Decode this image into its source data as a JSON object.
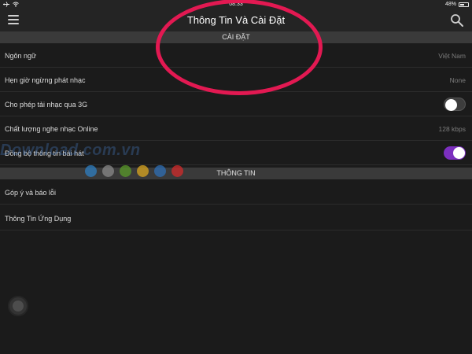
{
  "status_bar": {
    "time": "08:33",
    "battery": "48%"
  },
  "nav": {
    "title": "Thông Tin Và Cài Đặt"
  },
  "settings_section": {
    "title": "CÀI ĐẶT",
    "rows": [
      {
        "label": "Ngôn ngữ",
        "value": "Việt Nam"
      },
      {
        "label": "Hẹn giờ ngừng phát nhạc",
        "value": "None"
      },
      {
        "label": "Cho phép tải nhạc qua 3G",
        "toggle": "off"
      },
      {
        "label": "Chất lượng nghe nhạc Online",
        "value": "128 kbps"
      },
      {
        "label": "Đồng bộ thông tin bài hát",
        "toggle": "on"
      }
    ]
  },
  "info_section": {
    "title": "THÔNG TIN",
    "rows": [
      {
        "label": "Góp ý và báo lỗi"
      },
      {
        "label": "Thông Tin Ứng Dụng"
      }
    ]
  },
  "watermark": {
    "text": "Download.com.vn"
  },
  "colors": {
    "background": "#1b1b1b",
    "section_header": "#3a3a3a",
    "toggle_on": "#7c2fbf",
    "highlight_circle": "#e21952",
    "dots": [
      "#2f7fc1",
      "#8a8a8a",
      "#5a9a2a",
      "#d9a520",
      "#2f6fb6",
      "#d12b2b"
    ]
  },
  "icons": {
    "menu": "hamburger-menu-icon",
    "search": "search-icon",
    "airplane": "airplane-icon",
    "wifi": "wifi-icon",
    "battery": "battery-icon"
  }
}
